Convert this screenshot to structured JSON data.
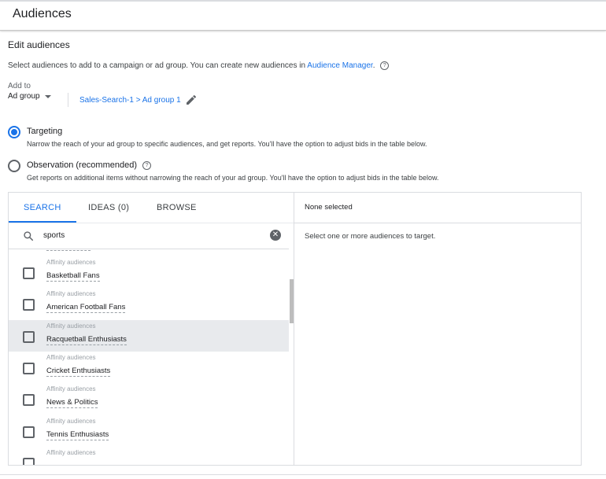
{
  "header": {
    "title": "Audiences"
  },
  "section": {
    "title": "Edit audiences",
    "description": "Select audiences to add to a campaign or ad group. You can create new audiences in ",
    "link": "Audience Manager",
    "after_link": ".",
    "help_icon": "help-icon"
  },
  "add_to": {
    "label": "Add to",
    "value": "Ad group",
    "breadcrumb": "Sales-Search-1 > Ad group 1",
    "edit_icon": "pencil-icon"
  },
  "options": [
    {
      "title": "Targeting",
      "desc": "Narrow the reach of your ad group to specific audiences, and get reports. You'll have the option to adjust bids in the table below.",
      "selected": true
    },
    {
      "title": "Observation (recommended)",
      "desc": "Get reports on additional items without narrowing the reach of your ad group. You'll have the option to adjust bids in the table below.",
      "selected": false
    }
  ],
  "tabs": [
    {
      "label": "SEARCH",
      "active": true
    },
    {
      "label": "IDEAS (0)",
      "active": false
    },
    {
      "label": "BROWSE",
      "active": false
    }
  ],
  "search": {
    "value": "sports"
  },
  "results": [
    {
      "category": "Affinity audiences",
      "name": "Basketball Fans"
    },
    {
      "category": "Affinity audiences",
      "name": "American Football Fans"
    },
    {
      "category": "Affinity audiences",
      "name": "Racquetball Enthusiasts",
      "highlighted": true
    },
    {
      "category": "Affinity audiences",
      "name": "Cricket Enthusiasts"
    },
    {
      "category": "Affinity audiences",
      "name": "News & Politics"
    },
    {
      "category": "Affinity audiences",
      "name": "Tennis Enthusiasts"
    },
    {
      "category": "Affinity audiences",
      "name": ""
    }
  ],
  "selected_pane": {
    "header": "None selected",
    "message": "Select one or more audiences to target."
  },
  "colors": {
    "accent": "#1a73e8",
    "highlight": "#e8eaed"
  }
}
